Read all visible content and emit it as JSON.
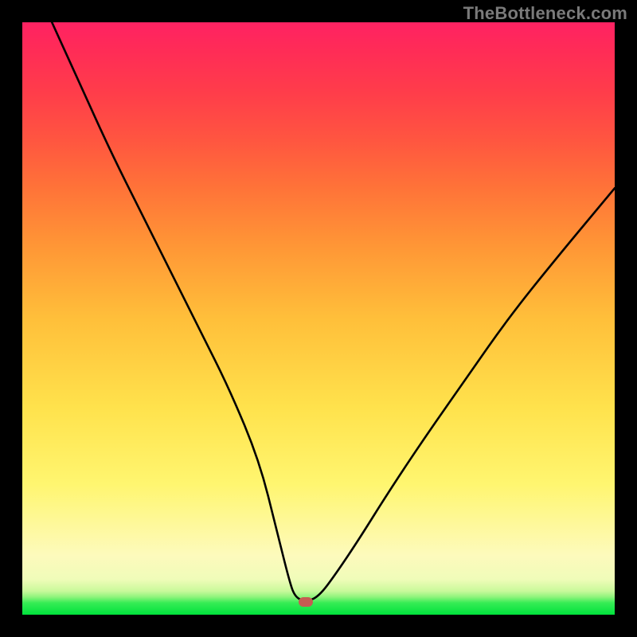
{
  "watermark": "TheBottleneck.com",
  "marker": {
    "x_pct": 47.8,
    "y_pct": 97.8,
    "color": "#c65c52"
  },
  "chart_data": {
    "type": "line",
    "title": "",
    "xlabel": "",
    "ylabel": "",
    "xlim": [
      0,
      100
    ],
    "ylim": [
      0,
      100
    ],
    "grid": false,
    "legend": null,
    "annotations": [
      "TheBottleneck.com"
    ],
    "marker_point": {
      "x": 47.8,
      "y": 2.2
    },
    "series": [
      {
        "name": "bottleneck-curve",
        "x": [
          5,
          10,
          15,
          20,
          25,
          30,
          35,
          40,
          43,
          45,
          46,
          47.8,
          50,
          53,
          57,
          62,
          68,
          75,
          82,
          90,
          100
        ],
        "y": [
          100,
          89,
          78,
          68,
          58,
          48,
          38,
          26,
          14,
          6,
          3,
          2.2,
          3,
          7,
          13,
          21,
          30,
          40,
          50,
          60,
          72
        ]
      }
    ],
    "background_gradient_stops": [
      {
        "pos": 0,
        "color": "#00e23c"
      },
      {
        "pos": 2,
        "color": "#36ec55"
      },
      {
        "pos": 3,
        "color": "#8ff47c"
      },
      {
        "pos": 4,
        "color": "#c9f99b"
      },
      {
        "pos": 6,
        "color": "#f0fcb9"
      },
      {
        "pos": 10,
        "color": "#fdfabc"
      },
      {
        "pos": 22,
        "color": "#fff670"
      },
      {
        "pos": 35,
        "color": "#ffe24c"
      },
      {
        "pos": 50,
        "color": "#ffbf3a"
      },
      {
        "pos": 62,
        "color": "#ff9736"
      },
      {
        "pos": 72,
        "color": "#ff7338"
      },
      {
        "pos": 80,
        "color": "#ff5640"
      },
      {
        "pos": 88,
        "color": "#ff3d4a"
      },
      {
        "pos": 96,
        "color": "#ff2a58"
      },
      {
        "pos": 100,
        "color": "#ff2263"
      }
    ]
  }
}
